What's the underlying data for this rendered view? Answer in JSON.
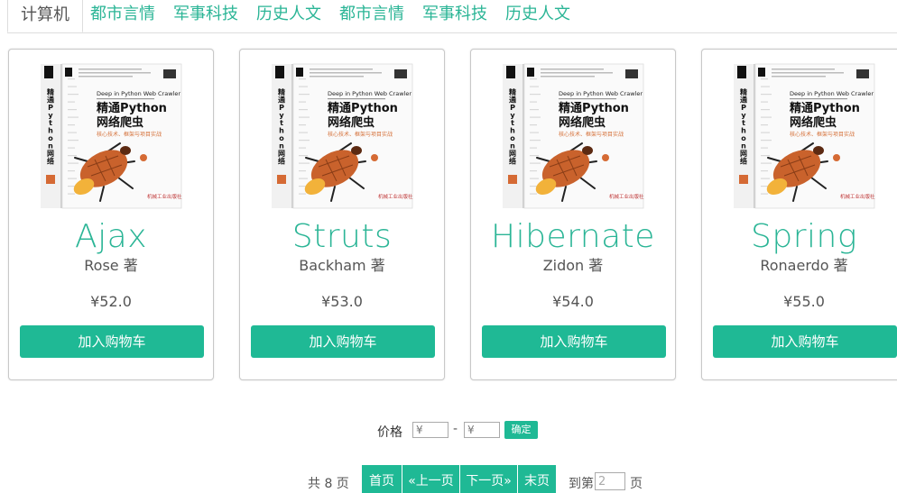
{
  "tabs": [
    {
      "label": "计算机",
      "active": true
    },
    {
      "label": "都市言情"
    },
    {
      "label": "军事科技"
    },
    {
      "label": "历史人文"
    },
    {
      "label": "都市言情"
    },
    {
      "label": "军事科技"
    },
    {
      "label": "历史人文"
    }
  ],
  "book_cover": {
    "title_line1": "精通Python",
    "title_line2": "网络爬虫",
    "english": "Deep in Python Web Crawler",
    "subtitle": "核心技术、框架与项目实战",
    "spine": "精通Python网络爬虫",
    "publisher": "机械工业出版社"
  },
  "products": [
    {
      "name": "Ajax",
      "author": "Rose 著",
      "price": "¥52.0",
      "cart_label": "加入购物车"
    },
    {
      "name": "Struts",
      "author": "Backham 著",
      "price": "¥53.0",
      "cart_label": "加入购物车"
    },
    {
      "name": "Hibernate",
      "author": "Zidon 著",
      "price": "¥54.0",
      "cart_label": "加入购物车"
    },
    {
      "name": "Spring",
      "author": "Ronaerdo 著",
      "price": "¥55.0",
      "cart_label": "加入购物车"
    }
  ],
  "price_filter": {
    "label": "价格",
    "min_placeholder": "¥",
    "separator": "-",
    "max_placeholder": "¥",
    "confirm_label": "确定"
  },
  "pagination": {
    "total": "共 8 页",
    "first": "首页",
    "prev": "«上一页",
    "next": "下一页»",
    "last": "末页",
    "goto_prefix": "到第",
    "goto_value": "2",
    "goto_suffix": "页"
  },
  "colors": {
    "accent": "#1fb995",
    "title": "#2bb596",
    "text": "#555555"
  }
}
